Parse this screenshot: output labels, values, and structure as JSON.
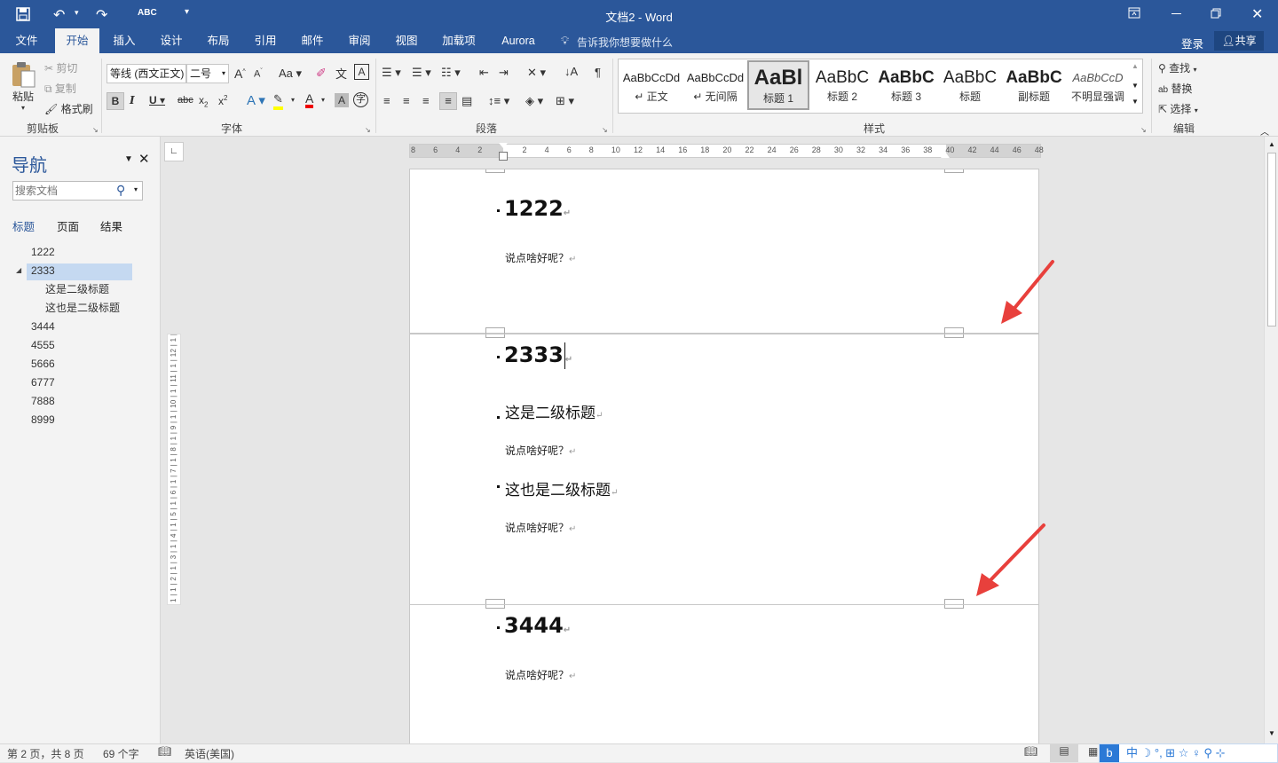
{
  "titlebar": {
    "title": "文档2 - Word"
  },
  "tabs": [
    {
      "label": "文件"
    },
    {
      "label": "开始"
    },
    {
      "label": "插入"
    },
    {
      "label": "设计"
    },
    {
      "label": "布局"
    },
    {
      "label": "引用"
    },
    {
      "label": "邮件"
    },
    {
      "label": "审阅"
    },
    {
      "label": "视图"
    },
    {
      "label": "加载项"
    },
    {
      "label": "Aurora"
    }
  ],
  "tellme": "告诉我你想要做什么",
  "account": {
    "login": "登录",
    "share": "共享"
  },
  "clipboard": {
    "paste": "粘贴",
    "cut": "剪切",
    "copy": "复制",
    "format_painter": "格式刷",
    "group": "剪贴板"
  },
  "font": {
    "name": "等线 (西文正文)",
    "size": "二号",
    "group": "字体"
  },
  "paragraph": {
    "group": "段落"
  },
  "styles": {
    "group": "样式",
    "items": [
      {
        "sample": "AaBbCcDd",
        "name": "↵ 正文"
      },
      {
        "sample": "AaBbCcDd",
        "name": "↵ 无间隔"
      },
      {
        "sample": "AaBl",
        "name": "标题 1"
      },
      {
        "sample": "AaBbC",
        "name": "标题 2"
      },
      {
        "sample": "AaBbC",
        "name": "标题 3"
      },
      {
        "sample": "AaBbC",
        "name": "标题"
      },
      {
        "sample": "AaBbC",
        "name": "副标题"
      },
      {
        "sample": "AaBbCcD",
        "name": "不明显强调"
      }
    ]
  },
  "editing": {
    "find": "查找",
    "replace": "替换",
    "select": "选择",
    "group": "编辑"
  },
  "nav": {
    "title": "导航",
    "search_placeholder": "搜索文档",
    "tabs": [
      "标题",
      "页面",
      "结果"
    ],
    "items": [
      {
        "label": "1222"
      },
      {
        "label": "2333"
      },
      {
        "label": "这是二级标题"
      },
      {
        "label": "这也是二级标题"
      },
      {
        "label": "3444"
      },
      {
        "label": "4555"
      },
      {
        "label": "5666"
      },
      {
        "label": "6777"
      },
      {
        "label": "7888"
      },
      {
        "label": "8999"
      }
    ]
  },
  "ruler_ticks": [
    "8",
    "6",
    "4",
    "2",
    "",
    "2",
    "4",
    "6",
    "8",
    "10",
    "12",
    "14",
    "16",
    "18",
    "20",
    "22",
    "24",
    "26",
    "28",
    "30",
    "32",
    "34",
    "36",
    "38",
    "40",
    "42",
    "44",
    "46",
    "48"
  ],
  "vruler_text": "1 | 1 | 2 | 1 | 3 | 1 | 4 | 1 | 5 | 1 | 6 | 1 | 7 | 1 | 8 | 1 | 9 | 1 | 10 | 1 | 11 | 1 | 12 | 1 | 13 | 1 | 14 | 1 | 15 | 1 | 16",
  "doc": {
    "h1a": "1222",
    "p1": "说点啥好呢？",
    "h1b": "2333",
    "h2a": "这是二级标题",
    "p2": "说点啥好呢？",
    "h2b": "这也是二级标题",
    "p3": "说点啥好呢？",
    "h1c": "3444",
    "p4": "说点啥好呢？",
    "para_mark": "↵"
  },
  "status": {
    "page": "第 2 页，共 8 页",
    "words": "69 个字",
    "lang": "英语(美国)"
  },
  "colors": {
    "accent": "#2b579a",
    "arrow": "#e8403c",
    "nav_selected": "#c5d9f1"
  }
}
